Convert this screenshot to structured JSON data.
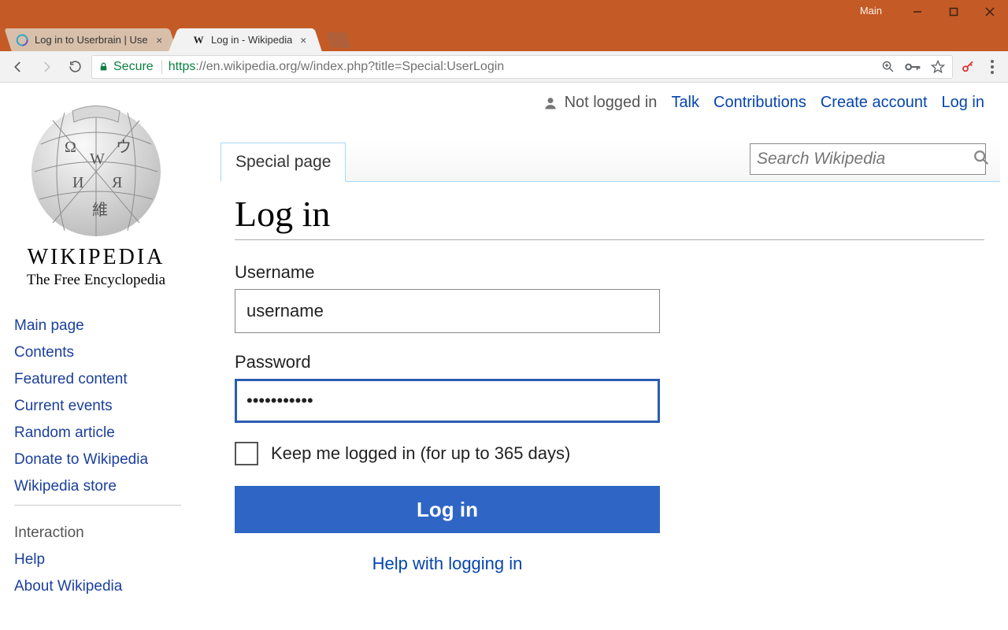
{
  "window": {
    "title": "Main"
  },
  "tabs": [
    {
      "title": "Log in to Userbrain | Use",
      "active": false
    },
    {
      "title": "Log in - Wikipedia",
      "active": true
    }
  ],
  "addressbar": {
    "secure_label": "Secure",
    "https": "https",
    "rest": "://en.wikipedia.org/w/index.php?title=Special:UserLogin"
  },
  "wikipedia": {
    "wordmark": "WIKIPEDIA",
    "tagline": "The Free Encyclopedia",
    "sidebar_links": [
      "Main page",
      "Contents",
      "Featured content",
      "Current events",
      "Random article",
      "Donate to Wikipedia",
      "Wikipedia store"
    ],
    "interaction_heading": "Interaction",
    "interaction_links": [
      "Help",
      "About Wikipedia"
    ],
    "topnav": {
      "not_logged": "Not logged in",
      "links": [
        "Talk",
        "Contributions",
        "Create account",
        "Log in"
      ]
    },
    "page_tab": "Special page",
    "search_placeholder": "Search Wikipedia",
    "heading": "Log in",
    "username_label": "Username",
    "username_value": "username",
    "password_label": "Password",
    "password_value": "•••••••••••",
    "keep_logged": "Keep me logged in (for up to 365 days)",
    "login_button": "Log in",
    "help_link": "Help with logging in"
  }
}
